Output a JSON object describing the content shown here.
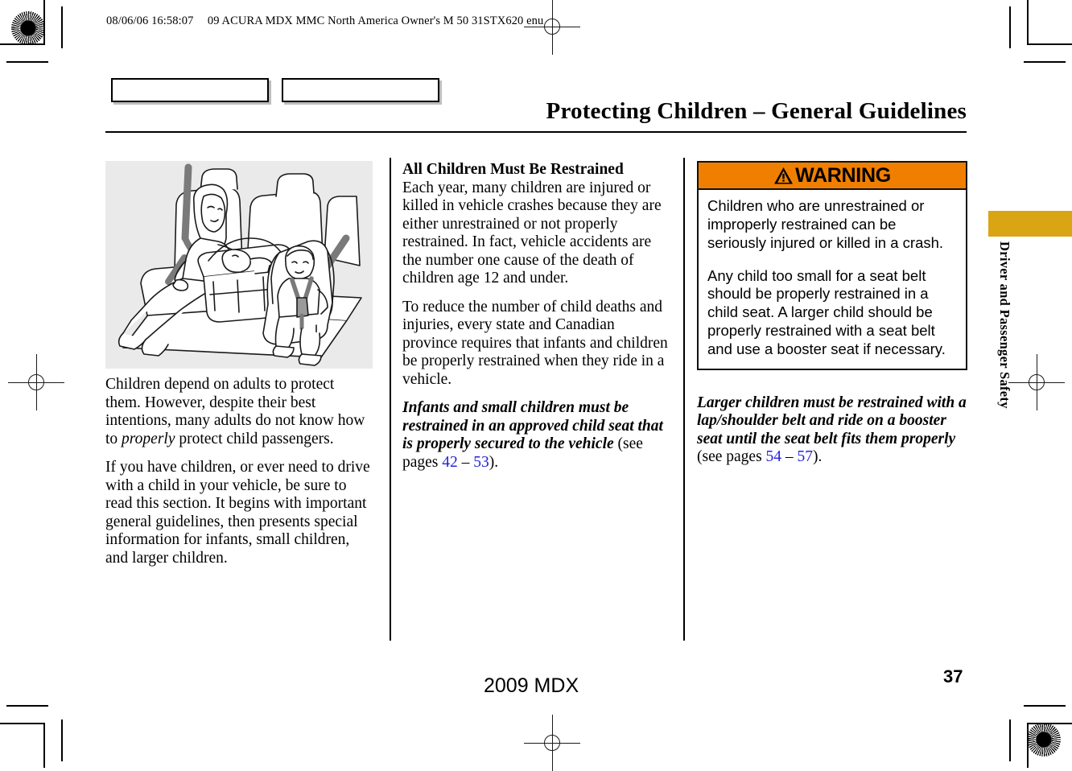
{
  "header": {
    "timestamp": "08/06/06 16:58:07",
    "doc_id": "09 ACURA MDX MMC North America Owner's M 50 31STX620 enu"
  },
  "title": "Protecting Children – General Guidelines",
  "left_column": {
    "figure_alt": "child-restraints-rear-seat-illustration",
    "paragraph_1_part1": "Children depend on adults to protect them. However, despite their best intentions, many adults do not know how to ",
    "paragraph_1_italic": "properly",
    "paragraph_1_part2": " protect child passengers.",
    "paragraph_2": "If you have children, or ever need to drive with a child in your vehicle, be sure to read this section. It begins with important general guidelines, then presents special information for infants, small children, and larger children."
  },
  "middle_column": {
    "subhead": "All Children Must Be Restrained",
    "paragraph_1": "Each year, many children are injured or killed in vehicle crashes because they are either unrestrained or not properly restrained. In fact, vehicle accidents are the number one cause of the death of children age 12 and under.",
    "paragraph_2": "To reduce the number of child deaths and injuries, every state and Canadian province requires that infants and children be properly restrained when they ride in a vehicle.",
    "paragraph_3_bold_italic": "Infants and small children must be restrained in an approved child seat that is properly secured to the vehicle",
    "paragraph_3_see_pages": " (see pages ",
    "paragraph_3_page_from": "42",
    "paragraph_3_dash": " – ",
    "paragraph_3_page_to": "53",
    "paragraph_3_close": ")."
  },
  "right_column": {
    "warning": {
      "label": "WARNING",
      "icon": "warning-triangle-icon",
      "header_color": "#f07f00",
      "paragraph_1": "Children who are unrestrained or improperly restrained can be seriously injured or killed in a crash.",
      "paragraph_2": "Any child too small for a seat belt should be properly restrained in a child seat. A larger child should be properly restrained with a seat belt and use a booster seat if necessary."
    },
    "note_bold_italic": "Larger children must be restrained with a lap/shoulder belt and ride on a booster seat until the seat belt fits them properly",
    "note_see_pages": " (see pages ",
    "note_page_from": "54",
    "note_dash": " – ",
    "note_page_to": "57",
    "note_close": ")."
  },
  "side_tab": {
    "label": "Driver and Passenger Safety",
    "color": "#d9a514"
  },
  "footer": {
    "model": "2009  MDX",
    "page_number": "37"
  }
}
